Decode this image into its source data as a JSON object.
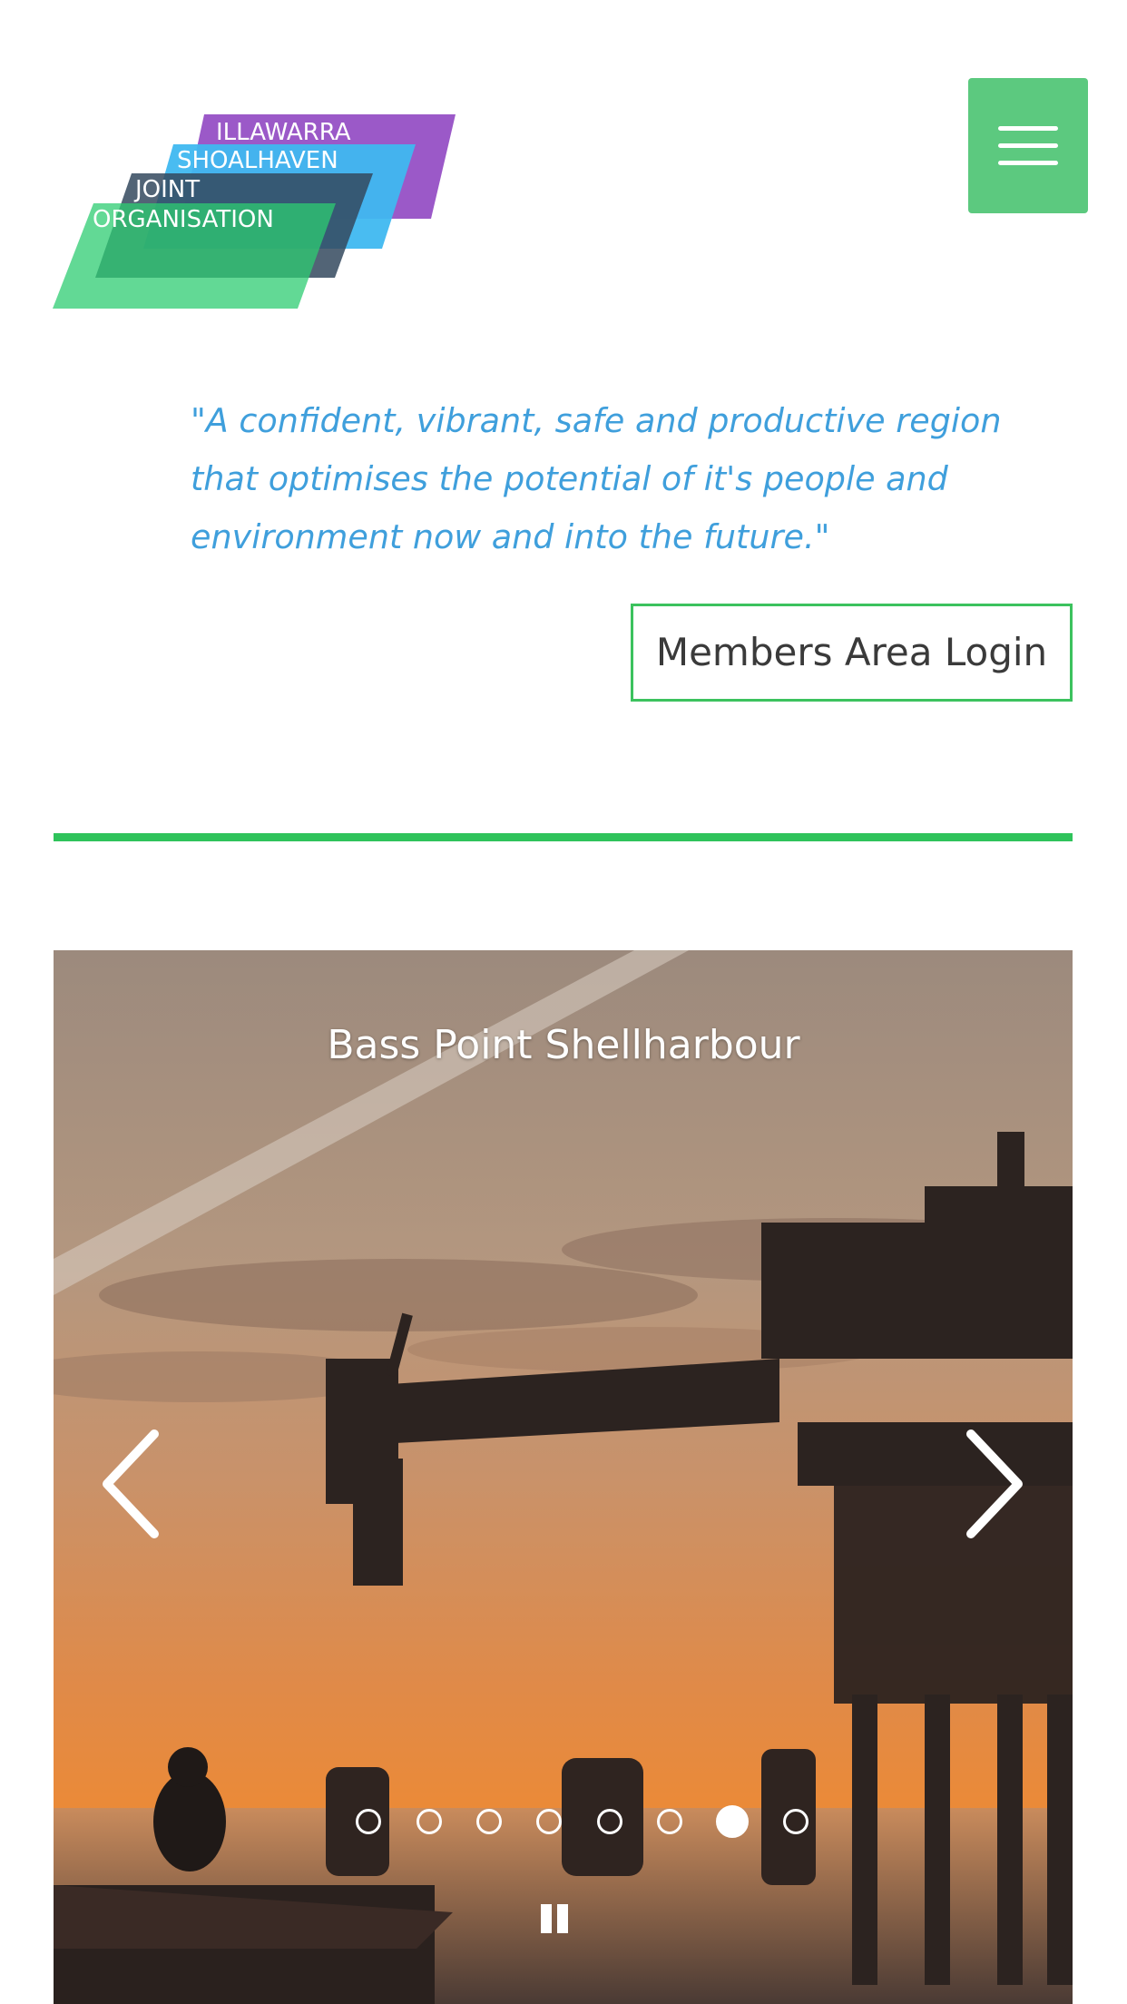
{
  "header": {
    "logo": {
      "lines": [
        "ILLAWARRA",
        "SHOALHAVEN",
        "JOINT",
        "ORGANISATION"
      ],
      "colors": [
        "#9b59c8",
        "#3fb8f0",
        "#34495e",
        "#2ecc71"
      ]
    },
    "menu_icon": "hamburger-icon",
    "menu_color": "#5cc97f"
  },
  "tagline": "\"A confident, vibrant, safe and productive region that optimises the potential of it's people and environment now and into the future.\"",
  "tagline_color": "#3f9fdc",
  "login_button": "Members Area Login",
  "accent_color": "#2fc35b",
  "slider": {
    "caption": "Bass Point Shellharbour",
    "prev_icon": "chevron-left-icon",
    "next_icon": "chevron-right-icon",
    "pause_icon": "pause-icon",
    "slide_count": 8,
    "active_slide": 7
  }
}
